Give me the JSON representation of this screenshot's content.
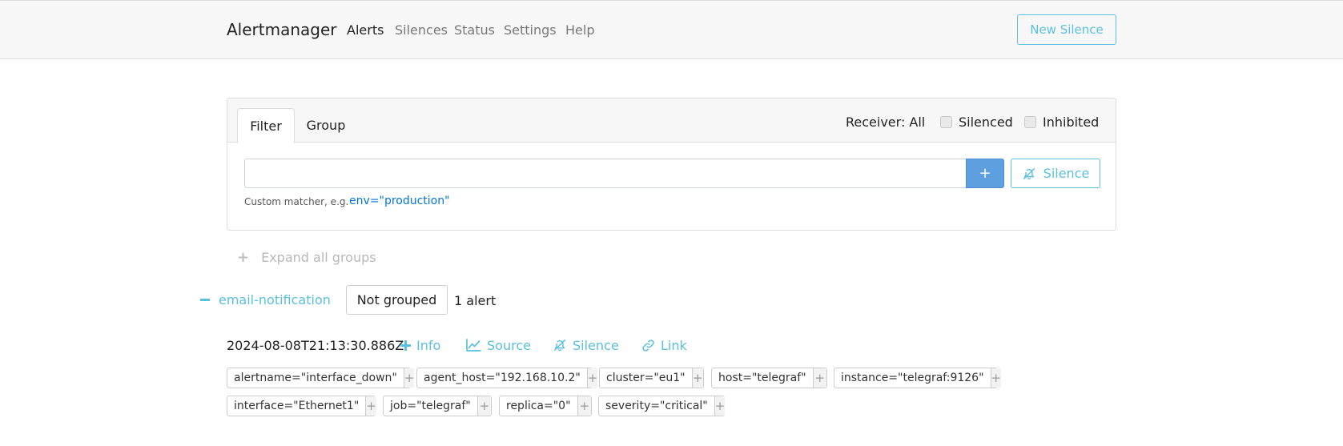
{
  "navbar": {
    "brand": "Alertmanager",
    "links": [
      "Alerts",
      "Silences",
      "Status",
      "Settings",
      "Help"
    ],
    "new_silence": "New Silence"
  },
  "filter_card": {
    "tabs": [
      "Filter",
      "Group"
    ],
    "receiver": "Receiver: All",
    "silenced": "Silenced",
    "inhibited": "Inhibited",
    "input_value": "",
    "add_button": "+",
    "silence_button": "Silence",
    "hint": "Custom matcher, e.g.",
    "example": "env=\"production\""
  },
  "expand_all": "Expand all groups",
  "group": {
    "name": "email-notification",
    "grouping": "Not grouped",
    "count": "1 alert"
  },
  "alert": {
    "timestamp": "2024-08-08T21:13:30.886Z",
    "actions": [
      "Info",
      "Source",
      "Silence",
      "Link"
    ],
    "labels": [
      "alertname=\"interface_down\"",
      "agent_host=\"192.168.10.2\"",
      "cluster=\"eu1\"",
      "host=\"telegraf\"",
      "instance=\"telegraf:9126\"",
      "interface=\"Ethernet1\"",
      "job=\"telegraf\"",
      "replica=\"0\"",
      "severity=\"critical\""
    ]
  },
  "colors": {
    "accent": "#5bc0de",
    "primary": "#5e9fe0",
    "link": "#0275d8"
  }
}
